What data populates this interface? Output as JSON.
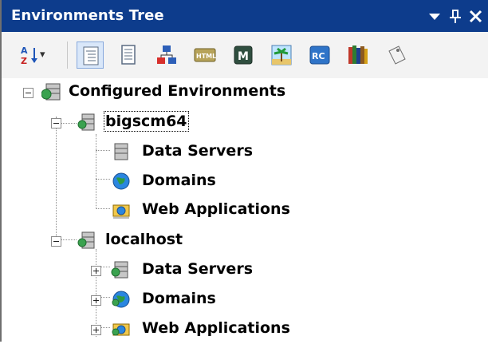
{
  "panel": {
    "title": "Environments Tree",
    "controls": {
      "menu": "▼",
      "pin": "⊥",
      "close": "✕"
    }
  },
  "toolbar": {
    "sort_icon": "sort-az-icon",
    "sort_arrow": "▾",
    "items": [
      {
        "name": "tree-view-icon"
      },
      {
        "name": "document-icon"
      },
      {
        "name": "hierarchy-icon"
      },
      {
        "name": "html-icon"
      },
      {
        "name": "m-icon"
      },
      {
        "name": "palm-tree-icon"
      },
      {
        "name": "rc-icon"
      },
      {
        "name": "books-icon"
      },
      {
        "name": "tag-icon"
      }
    ]
  },
  "tree": {
    "root": "Configured Environments",
    "environments": [
      {
        "name": "bigscm64",
        "expanded": true,
        "children": [
          "Data Servers",
          "Domains",
          "Web Applications"
        ]
      },
      {
        "name": "localhost",
        "expanded": true,
        "children": [
          "Data Servers",
          "Domains",
          "Web Applications"
        ]
      }
    ]
  },
  "colors": {
    "titlebar": "#0d3c8c",
    "toolbar_bg": "#f3f3f3"
  }
}
